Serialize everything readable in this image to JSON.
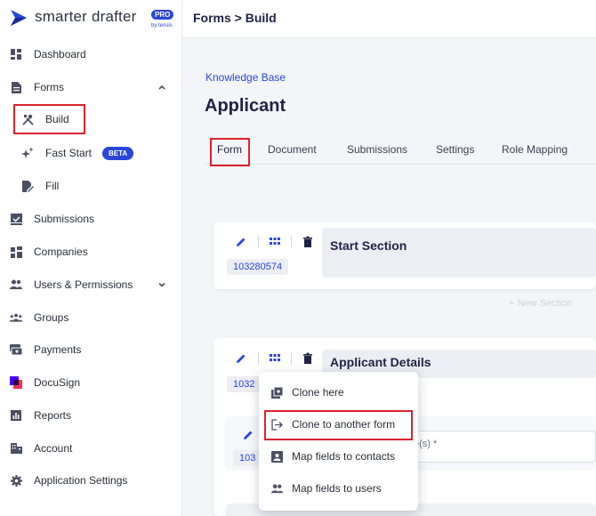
{
  "brand": {
    "name": "smarter drafter",
    "badge": "PRO",
    "byline": "by tensis",
    "accent": "#2946d9"
  },
  "sidebar": {
    "items": [
      {
        "label": "Dashboard",
        "icon": "dashboard-icon"
      },
      {
        "label": "Forms",
        "icon": "document-icon",
        "expanded": true
      },
      {
        "label": "Build",
        "icon": "tools-icon",
        "sub": true,
        "selected": true
      },
      {
        "label": "Fast Start",
        "icon": "sparkle-icon",
        "sub": true,
        "badge": "BETA"
      },
      {
        "label": "Fill",
        "icon": "fill-icon",
        "sub": true
      },
      {
        "label": "Submissions",
        "icon": "inbox-check-icon"
      },
      {
        "label": "Companies",
        "icon": "companies-icon"
      },
      {
        "label": "Users & Permissions",
        "icon": "users-icon",
        "expanded": false
      },
      {
        "label": "Groups",
        "icon": "groups-icon"
      },
      {
        "label": "Payments",
        "icon": "payments-icon"
      },
      {
        "label": "DocuSign",
        "icon": "docusign-icon"
      },
      {
        "label": "Reports",
        "icon": "reports-icon"
      },
      {
        "label": "Account",
        "icon": "account-icon"
      },
      {
        "label": "Application Settings",
        "icon": "gear-icon"
      }
    ]
  },
  "header": {
    "breadcrumb": "Forms > Build"
  },
  "main": {
    "kb_link": "Knowledge Base",
    "title": "Applicant",
    "tabs": [
      "Form",
      "Document",
      "Submissions",
      "Settings",
      "Role Mapping"
    ],
    "active_tab": "Form",
    "sections": [
      {
        "id": "103280574",
        "title": "Start Section"
      },
      {
        "id": "1032",
        "title": "Applicant Details"
      }
    ],
    "new_section_label": "+ New Section",
    "nested_id": "103",
    "partial_field_text": "e(s) *"
  },
  "context_menu": {
    "items": [
      {
        "label": "Clone here",
        "icon": "clone-icon"
      },
      {
        "label": "Clone to another form",
        "icon": "export-icon",
        "highlighted": true
      },
      {
        "label": "Map fields to contacts",
        "icon": "contact-card-icon"
      },
      {
        "label": "Map fields to users",
        "icon": "users-icon"
      }
    ]
  },
  "colors": {
    "highlight_box": "#d9232d",
    "link": "#2946d9",
    "title": "#1f2247"
  }
}
